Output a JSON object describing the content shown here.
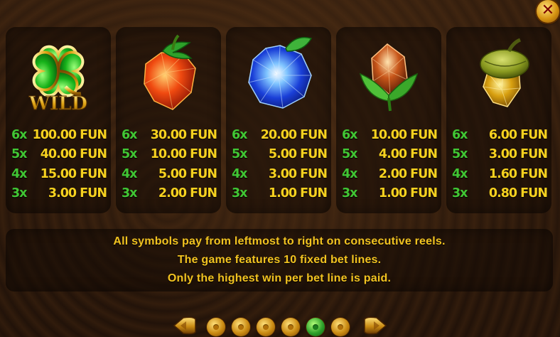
{
  "paytable": {
    "symbols": [
      {
        "icon": "clover-wild-icon",
        "label": "WILD",
        "pays": [
          {
            "count": "6x",
            "amount": "100.00 FUN"
          },
          {
            "count": "5x",
            "amount": "40.00 FUN"
          },
          {
            "count": "4x",
            "amount": "15.00 FUN"
          },
          {
            "count": "3x",
            "amount": "3.00 FUN"
          }
        ]
      },
      {
        "icon": "strawberry-gem-icon",
        "pays": [
          {
            "count": "6x",
            "amount": "30.00 FUN"
          },
          {
            "count": "5x",
            "amount": "10.00 FUN"
          },
          {
            "count": "4x",
            "amount": "5.00 FUN"
          },
          {
            "count": "3x",
            "amount": "2.00 FUN"
          }
        ]
      },
      {
        "icon": "blueberry-gem-icon",
        "pays": [
          {
            "count": "6x",
            "amount": "20.00 FUN"
          },
          {
            "count": "5x",
            "amount": "5.00 FUN"
          },
          {
            "count": "4x",
            "amount": "3.00 FUN"
          },
          {
            "count": "3x",
            "amount": "1.00 FUN"
          }
        ]
      },
      {
        "icon": "amber-bud-gem-icon",
        "pays": [
          {
            "count": "6x",
            "amount": "10.00 FUN"
          },
          {
            "count": "5x",
            "amount": "4.00 FUN"
          },
          {
            "count": "4x",
            "amount": "2.00 FUN"
          },
          {
            "count": "3x",
            "amount": "1.00 FUN"
          }
        ]
      },
      {
        "icon": "acorn-gem-icon",
        "pays": [
          {
            "count": "6x",
            "amount": "6.00 FUN"
          },
          {
            "count": "5x",
            "amount": "3.00 FUN"
          },
          {
            "count": "4x",
            "amount": "1.60 FUN"
          },
          {
            "count": "3x",
            "amount": "0.80 FUN"
          }
        ]
      }
    ]
  },
  "info": {
    "lines": [
      "All symbols pay from leftmost to right on consecutive reels.",
      "The game features 10 fixed bet lines.",
      "Only the highest win per bet line is paid."
    ]
  },
  "pager": {
    "total_pages": 6,
    "current_page": 5
  },
  "controls": {
    "close_icon": "close-icon",
    "prev_icon": "arrow-left-icon",
    "next_icon": "arrow-right-icon"
  },
  "colors": {
    "count": "#41c634",
    "amount": "#f6d11f",
    "info_text": "#f2c320",
    "gold": "#d69412"
  }
}
